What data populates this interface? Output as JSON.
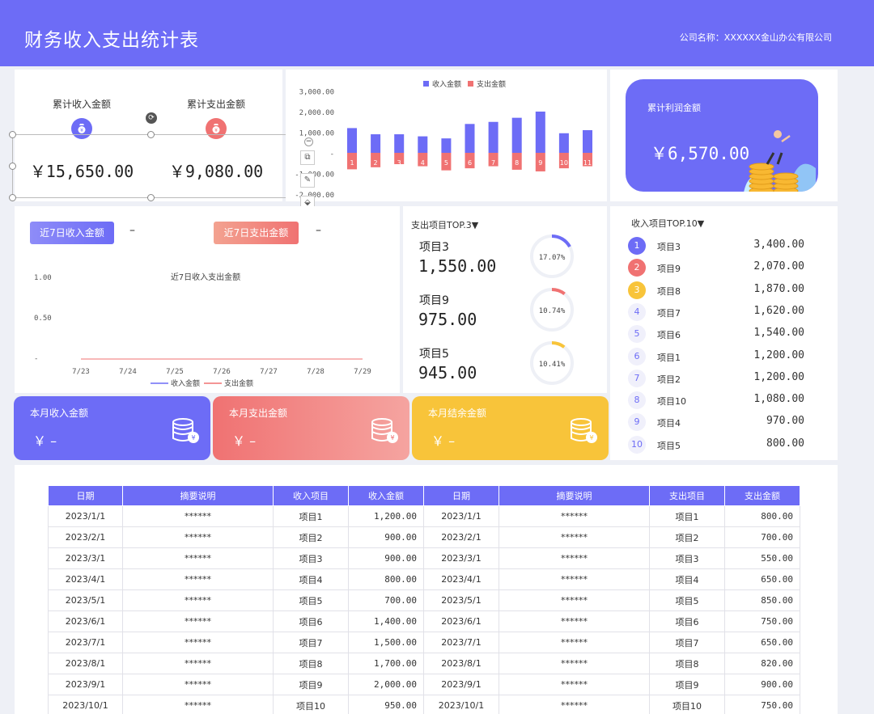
{
  "header": {
    "title": "财务收入支出统计表",
    "company": "公司名称：XXXXXX金山办公有限公司"
  },
  "stats": {
    "income_label": "累计收入金额",
    "income_value": "￥15,650.00",
    "expense_label": "累计支出金额",
    "expense_value": "￥9,080.00",
    "profit_label": "累计利润金额",
    "profit_value": "￥6,570.00"
  },
  "colors": {
    "accent": "#6d6cf6",
    "expense": "#f07272",
    "yellow": "#f8c43a"
  },
  "chart_data": [
    {
      "type": "bar",
      "categories": [
        "1",
        "2",
        "3",
        "4",
        "5",
        "6",
        "7",
        "8",
        "9",
        "10",
        "11"
      ],
      "series": [
        {
          "name": "收入金额",
          "values": [
            1200,
            900,
            900,
            800,
            700,
            1400,
            1500,
            1700,
            2000,
            950,
            1100
          ]
        },
        {
          "name": "支出金额",
          "values": [
            -800,
            -700,
            -550,
            -650,
            -850,
            -750,
            -650,
            -820,
            -900,
            -750,
            -650
          ]
        }
      ],
      "ylim": [
        -2000,
        3000
      ],
      "yticks": [
        "3,000.00",
        "2,000.00",
        "1,000.00",
        "-",
        "-1,000.00",
        "-2,000.00"
      ],
      "legend": "top"
    },
    {
      "type": "line",
      "title": "近7日收入支出金额",
      "categories": [
        "7/23",
        "7/24",
        "7/25",
        "7/26",
        "7/27",
        "7/28",
        "7/29"
      ],
      "series": [
        {
          "name": "收入金额",
          "values": [
            0,
            0,
            0,
            0,
            0,
            0,
            0
          ]
        },
        {
          "name": "支出金额",
          "values": [
            0,
            0,
            0,
            0,
            0,
            0,
            0
          ]
        }
      ],
      "yticks": [
        "1.00",
        "0.50",
        "-"
      ],
      "legend": "bottom"
    }
  ],
  "week": {
    "income_btn": "近7日收入金额",
    "expense_btn": "近7日支出金额",
    "income_dash": "–",
    "expense_dash": "–"
  },
  "expense_top": {
    "title": "支出项目TOP.3▼",
    "items": [
      {
        "name": "项目3",
        "amount": "1,550.00",
        "pct": "17.07%",
        "fraction": 0.1707,
        "color": "#6d6cf6"
      },
      {
        "name": "项目9",
        "amount": "975.00",
        "pct": "10.74%",
        "fraction": 0.1074,
        "color": "#f07272"
      },
      {
        "name": "项目5",
        "amount": "945.00",
        "pct": "10.41%",
        "fraction": 0.1041,
        "color": "#f8c43a"
      }
    ]
  },
  "income_top": {
    "title": "收入项目TOP.10▼",
    "items": [
      {
        "rank": "1",
        "name": "项目3",
        "amount": "3,400.00"
      },
      {
        "rank": "2",
        "name": "项目9",
        "amount": "2,070.00"
      },
      {
        "rank": "3",
        "name": "项目8",
        "amount": "1,870.00"
      },
      {
        "rank": "4",
        "name": "项目7",
        "amount": "1,620.00"
      },
      {
        "rank": "5",
        "name": "项目6",
        "amount": "1,540.00"
      },
      {
        "rank": "6",
        "name": "项目1",
        "amount": "1,200.00"
      },
      {
        "rank": "7",
        "name": "项目2",
        "amount": "1,200.00"
      },
      {
        "rank": "8",
        "name": "项目10",
        "amount": "1,080.00"
      },
      {
        "rank": "9",
        "name": "项目4",
        "amount": "970.00"
      },
      {
        "rank": "10",
        "name": "项目5",
        "amount": "800.00"
      }
    ]
  },
  "month": {
    "income_label": "本月收入金额",
    "income_value": "￥ –",
    "expense_label": "本月支出金额",
    "expense_value": "￥ –",
    "balance_label": "本月结余金额",
    "balance_value": "￥ –"
  },
  "table": {
    "headers": [
      "日期",
      "摘要说明",
      "收入项目",
      "收入金额",
      "日期",
      "摘要说明",
      "支出项目",
      "支出金额"
    ],
    "rows": [
      [
        "2023/1/1",
        "******",
        "项目1",
        "1,200.00",
        "2023/1/1",
        "******",
        "项目1",
        "800.00"
      ],
      [
        "2023/2/1",
        "******",
        "项目2",
        "900.00",
        "2023/2/1",
        "******",
        "项目2",
        "700.00"
      ],
      [
        "2023/3/1",
        "******",
        "项目3",
        "900.00",
        "2023/3/1",
        "******",
        "项目3",
        "550.00"
      ],
      [
        "2023/4/1",
        "******",
        "项目4",
        "800.00",
        "2023/4/1",
        "******",
        "项目4",
        "650.00"
      ],
      [
        "2023/5/1",
        "******",
        "项目5",
        "700.00",
        "2023/5/1",
        "******",
        "项目5",
        "850.00"
      ],
      [
        "2023/6/1",
        "******",
        "项目6",
        "1,400.00",
        "2023/6/1",
        "******",
        "项目6",
        "750.00"
      ],
      [
        "2023/7/1",
        "******",
        "项目7",
        "1,500.00",
        "2023/7/1",
        "******",
        "项目7",
        "650.00"
      ],
      [
        "2023/8/1",
        "******",
        "项目8",
        "1,700.00",
        "2023/8/1",
        "******",
        "项目8",
        "820.00"
      ],
      [
        "2023/9/1",
        "******",
        "项目9",
        "2,000.00",
        "2023/9/1",
        "******",
        "项目9",
        "900.00"
      ],
      [
        "2023/10/1",
        "******",
        "项目10",
        "950.00",
        "2023/10/1",
        "******",
        "项目10",
        "750.00"
      ]
    ]
  }
}
